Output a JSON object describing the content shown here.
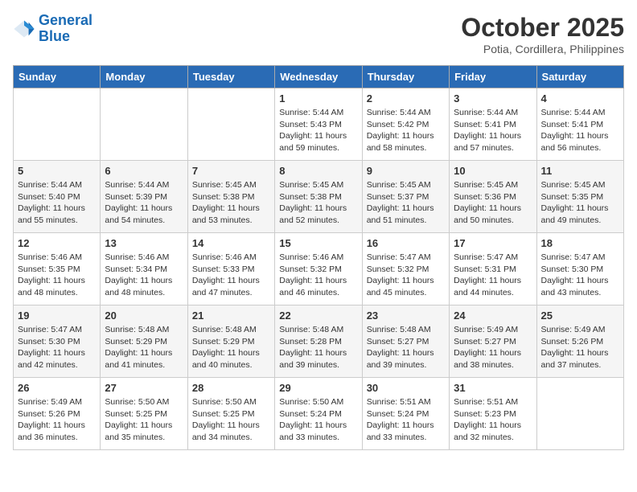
{
  "header": {
    "logo_line1": "General",
    "logo_line2": "Blue",
    "month": "October 2025",
    "location": "Potia, Cordillera, Philippines"
  },
  "weekdays": [
    "Sunday",
    "Monday",
    "Tuesday",
    "Wednesday",
    "Thursday",
    "Friday",
    "Saturday"
  ],
  "weeks": [
    [
      {
        "day": "",
        "info": ""
      },
      {
        "day": "",
        "info": ""
      },
      {
        "day": "",
        "info": ""
      },
      {
        "day": "1",
        "info": "Sunrise: 5:44 AM\nSunset: 5:43 PM\nDaylight: 11 hours\nand 59 minutes."
      },
      {
        "day": "2",
        "info": "Sunrise: 5:44 AM\nSunset: 5:42 PM\nDaylight: 11 hours\nand 58 minutes."
      },
      {
        "day": "3",
        "info": "Sunrise: 5:44 AM\nSunset: 5:41 PM\nDaylight: 11 hours\nand 57 minutes."
      },
      {
        "day": "4",
        "info": "Sunrise: 5:44 AM\nSunset: 5:41 PM\nDaylight: 11 hours\nand 56 minutes."
      }
    ],
    [
      {
        "day": "5",
        "info": "Sunrise: 5:44 AM\nSunset: 5:40 PM\nDaylight: 11 hours\nand 55 minutes."
      },
      {
        "day": "6",
        "info": "Sunrise: 5:44 AM\nSunset: 5:39 PM\nDaylight: 11 hours\nand 54 minutes."
      },
      {
        "day": "7",
        "info": "Sunrise: 5:45 AM\nSunset: 5:38 PM\nDaylight: 11 hours\nand 53 minutes."
      },
      {
        "day": "8",
        "info": "Sunrise: 5:45 AM\nSunset: 5:38 PM\nDaylight: 11 hours\nand 52 minutes."
      },
      {
        "day": "9",
        "info": "Sunrise: 5:45 AM\nSunset: 5:37 PM\nDaylight: 11 hours\nand 51 minutes."
      },
      {
        "day": "10",
        "info": "Sunrise: 5:45 AM\nSunset: 5:36 PM\nDaylight: 11 hours\nand 50 minutes."
      },
      {
        "day": "11",
        "info": "Sunrise: 5:45 AM\nSunset: 5:35 PM\nDaylight: 11 hours\nand 49 minutes."
      }
    ],
    [
      {
        "day": "12",
        "info": "Sunrise: 5:46 AM\nSunset: 5:35 PM\nDaylight: 11 hours\nand 48 minutes."
      },
      {
        "day": "13",
        "info": "Sunrise: 5:46 AM\nSunset: 5:34 PM\nDaylight: 11 hours\nand 48 minutes."
      },
      {
        "day": "14",
        "info": "Sunrise: 5:46 AM\nSunset: 5:33 PM\nDaylight: 11 hours\nand 47 minutes."
      },
      {
        "day": "15",
        "info": "Sunrise: 5:46 AM\nSunset: 5:32 PM\nDaylight: 11 hours\nand 46 minutes."
      },
      {
        "day": "16",
        "info": "Sunrise: 5:47 AM\nSunset: 5:32 PM\nDaylight: 11 hours\nand 45 minutes."
      },
      {
        "day": "17",
        "info": "Sunrise: 5:47 AM\nSunset: 5:31 PM\nDaylight: 11 hours\nand 44 minutes."
      },
      {
        "day": "18",
        "info": "Sunrise: 5:47 AM\nSunset: 5:30 PM\nDaylight: 11 hours\nand 43 minutes."
      }
    ],
    [
      {
        "day": "19",
        "info": "Sunrise: 5:47 AM\nSunset: 5:30 PM\nDaylight: 11 hours\nand 42 minutes."
      },
      {
        "day": "20",
        "info": "Sunrise: 5:48 AM\nSunset: 5:29 PM\nDaylight: 11 hours\nand 41 minutes."
      },
      {
        "day": "21",
        "info": "Sunrise: 5:48 AM\nSunset: 5:29 PM\nDaylight: 11 hours\nand 40 minutes."
      },
      {
        "day": "22",
        "info": "Sunrise: 5:48 AM\nSunset: 5:28 PM\nDaylight: 11 hours\nand 39 minutes."
      },
      {
        "day": "23",
        "info": "Sunrise: 5:48 AM\nSunset: 5:27 PM\nDaylight: 11 hours\nand 39 minutes."
      },
      {
        "day": "24",
        "info": "Sunrise: 5:49 AM\nSunset: 5:27 PM\nDaylight: 11 hours\nand 38 minutes."
      },
      {
        "day": "25",
        "info": "Sunrise: 5:49 AM\nSunset: 5:26 PM\nDaylight: 11 hours\nand 37 minutes."
      }
    ],
    [
      {
        "day": "26",
        "info": "Sunrise: 5:49 AM\nSunset: 5:26 PM\nDaylight: 11 hours\nand 36 minutes."
      },
      {
        "day": "27",
        "info": "Sunrise: 5:50 AM\nSunset: 5:25 PM\nDaylight: 11 hours\nand 35 minutes."
      },
      {
        "day": "28",
        "info": "Sunrise: 5:50 AM\nSunset: 5:25 PM\nDaylight: 11 hours\nand 34 minutes."
      },
      {
        "day": "29",
        "info": "Sunrise: 5:50 AM\nSunset: 5:24 PM\nDaylight: 11 hours\nand 33 minutes."
      },
      {
        "day": "30",
        "info": "Sunrise: 5:51 AM\nSunset: 5:24 PM\nDaylight: 11 hours\nand 33 minutes."
      },
      {
        "day": "31",
        "info": "Sunrise: 5:51 AM\nSunset: 5:23 PM\nDaylight: 11 hours\nand 32 minutes."
      },
      {
        "day": "",
        "info": ""
      }
    ]
  ]
}
